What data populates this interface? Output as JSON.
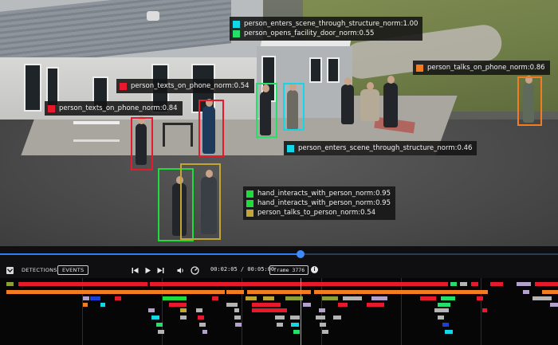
{
  "colors": {
    "red": "#e8192c",
    "green": "#1edc3c",
    "cyan": "#13d7e6",
    "orange": "#f47c20",
    "olive": "#c2a635",
    "lime": "#24e06a",
    "accent_blue": "#2f7df4"
  },
  "labels": [
    {
      "id": "struct",
      "rows": [
        {
          "text": "person_enters_scene_through_structure_norm:1.00",
          "color": "#13d7e6"
        },
        {
          "text": "person_opens_facility_door_norm:0.55",
          "color": "#24e06a"
        }
      ]
    },
    {
      "id": "phone-right",
      "rows": [
        {
          "text": "person_talks_on_phone_norm:0.86",
          "color": "#f47c20"
        }
      ]
    },
    {
      "id": "texts1",
      "rows": [
        {
          "text": "person_texts_on_phone_norm:0.54",
          "color": "#e8192c"
        }
      ]
    },
    {
      "id": "texts2",
      "rows": [
        {
          "text": "person_texts_on_phone_norm:0.84",
          "color": "#e8192c"
        }
      ]
    },
    {
      "id": "struct2",
      "rows": [
        {
          "text": "person_enters_scene_through_structure_norm:0.46",
          "color": "#13d7e6"
        }
      ]
    },
    {
      "id": "hand",
      "rows": [
        {
          "text": "hand_interacts_with_person_norm:0.95",
          "color": "#1edc3c"
        },
        {
          "text": "hand_interacts_with_person_norm:0.95",
          "color": "#1edc3c"
        },
        {
          "text": "person_talks_to_person_norm:0.54",
          "color": "#c2a635"
        }
      ]
    }
  ],
  "player": {
    "progress": 0.417,
    "tabs": [
      "DETECTIONS",
      "EVENTS"
    ],
    "active_tab": "EVENTS",
    "time": "00:02:05 / 00:05:00",
    "frame": "frame 3776",
    "icons": [
      "collapse-icon",
      "skip-back-icon",
      "play-icon",
      "skip-forward-icon",
      "volume-icon",
      "speed-icon",
      "info-icon"
    ]
  }
}
